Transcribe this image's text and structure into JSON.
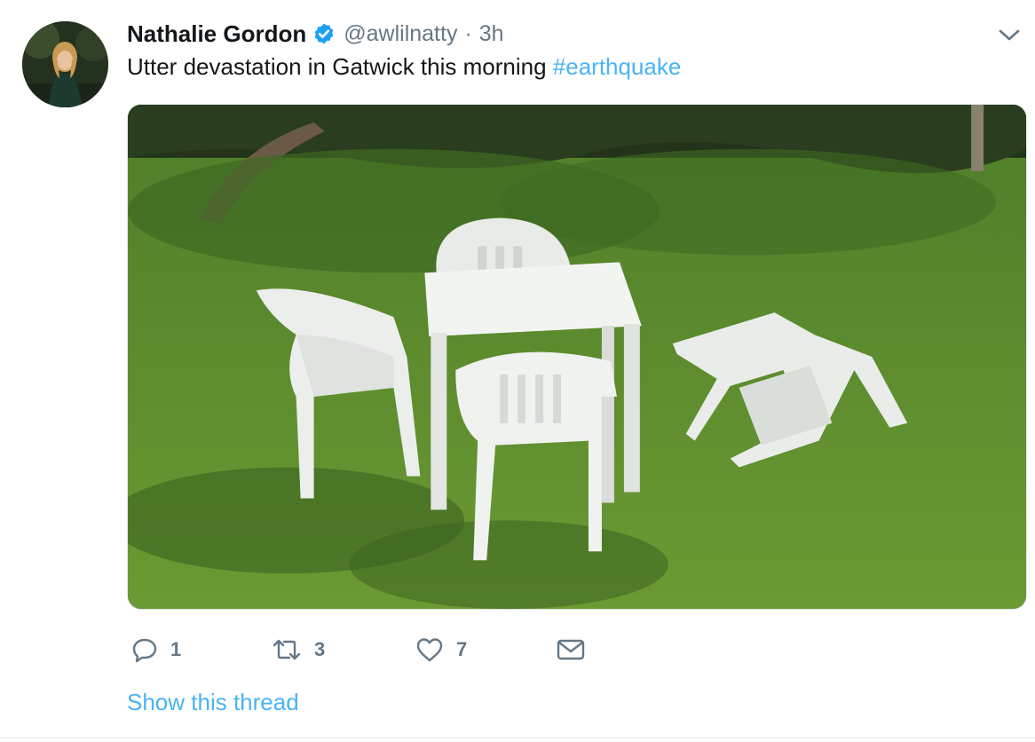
{
  "tweet": {
    "author": {
      "name": "Nathalie Gordon",
      "verified_icon": "verified-badge-icon",
      "handle": "@awlilnatty",
      "separator": "·",
      "time": "3h"
    },
    "text": "Utter devastation in Gatwick this morning",
    "hashtag": "#earthquake",
    "media": {
      "kind": "photo",
      "icon": "photo-white-plastic-chairs-on-lawn"
    },
    "actions": {
      "reply": {
        "icon": "reply-icon",
        "count": "1"
      },
      "retweet": {
        "icon": "retweet-icon",
        "count": "3"
      },
      "like": {
        "icon": "heart-icon",
        "count": "7"
      },
      "message": {
        "icon": "envelope-icon"
      }
    },
    "show_thread": "Show this thread",
    "menu_icon": "chevron-down-icon"
  },
  "colors": {
    "link": "#4ab3f4",
    "muted": "#657786",
    "text": "#14171a",
    "verified": "#1da1f2"
  }
}
